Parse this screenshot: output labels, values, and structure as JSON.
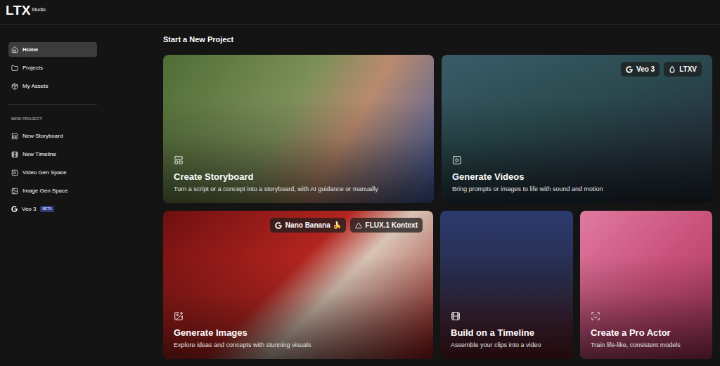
{
  "logo": {
    "text": "LTX",
    "sub": "Studio"
  },
  "sidebar": {
    "items": [
      {
        "label": "Home",
        "selected": true
      },
      {
        "label": "Projects",
        "selected": false
      },
      {
        "label": "My Assets",
        "selected": false
      }
    ],
    "section": "NEW PROJECT",
    "new_items": [
      {
        "label": "New Storyboard",
        "badge": ""
      },
      {
        "label": "New Timeline",
        "badge": ""
      },
      {
        "label": "Video Gen Space",
        "badge": ""
      },
      {
        "label": "Image Gen Space",
        "badge": ""
      },
      {
        "label": "Veo 3",
        "badge": "BETA"
      }
    ]
  },
  "main": {
    "title": "Start a New Project",
    "cards": [
      {
        "title": "Create Storyboard",
        "subtitle": "Turn a script or a concept into a storyboard, with AI guidance or manually",
        "badges": []
      },
      {
        "title": "Generate Videos",
        "subtitle": "Bring prompts or images to life with sound and motion",
        "badges": [
          "Veo 3",
          "LTXV"
        ]
      },
      {
        "title": "Generate Images",
        "subtitle": "Explore ideas and concepts with stunning visuals",
        "badges": [
          "Nano Banana 🍌",
          "FLUX.1 Kontext"
        ]
      },
      {
        "title": "Build on a Timeline",
        "subtitle": "Assemble your clips into a video",
        "badges": []
      },
      {
        "title": "Create a Pro Actor",
        "subtitle": "Train life-like, consistent models",
        "badges": []
      }
    ]
  }
}
